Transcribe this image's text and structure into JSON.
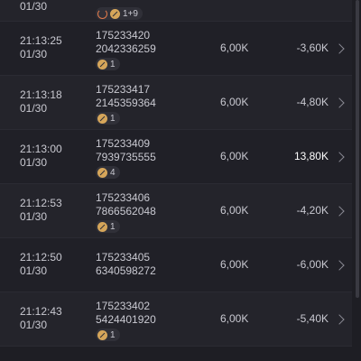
{
  "rows": [
    {
      "time": "",
      "date": "01/30",
      "id1": "",
      "id2": "",
      "badge": "1+9",
      "amount": "",
      "profit": "",
      "partial": true
    },
    {
      "time": "21:13:25",
      "date": "01/30",
      "id1": "175233420",
      "id2": "2042336259",
      "badge": "1",
      "amount": "6,00K",
      "profit": "-3,60K"
    },
    {
      "time": "21:13:18",
      "date": "01/30",
      "id1": "175233417",
      "id2": "2145359364",
      "badge": "1",
      "amount": "6,00K",
      "profit": "-4,80K"
    },
    {
      "time": "21:13:00",
      "date": "01/30",
      "id1": "175233409",
      "id2": "7939735555",
      "badge": "4",
      "amount": "6,00K",
      "profit": "13,80K"
    },
    {
      "time": "21:12:53",
      "date": "01/30",
      "id1": "175233406",
      "id2": "7866562048",
      "badge": "1",
      "amount": "6,00K",
      "profit": "-4,20K"
    },
    {
      "time": "21:12:50",
      "date": "01/30",
      "id1": "175233405",
      "id2": "6340598272",
      "badge": "",
      "amount": "6,00K",
      "profit": "-6,00K"
    },
    {
      "time": "21:12:43",
      "date": "01/30",
      "id1": "175233402",
      "id2": "5424401920",
      "badge": "1",
      "amount": "6,00K",
      "profit": "-5,40K"
    }
  ],
  "icons": {
    "badge": "bet-coin-icon",
    "refresh": "refresh-icon",
    "chevron": "chevron-right-icon"
  },
  "colors": {
    "background": "#1e1e24",
    "text": "#c9c9d1",
    "positive": "#ffffff",
    "badge_icon": "#d6a65a"
  }
}
